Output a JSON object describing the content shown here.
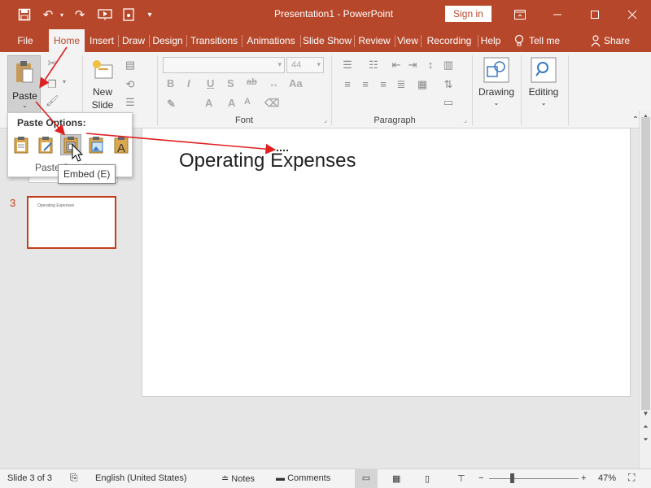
{
  "titlebar": {
    "title": "Presentation1  -  PowerPoint",
    "signin_label": "Sign in",
    "qat_icons": [
      "save-icon",
      "undo-icon",
      "redo-icon",
      "present-from-start-icon",
      "touch-mode-icon",
      "customize-qat-icon"
    ],
    "window_icons": [
      "ribbon-display-options-icon",
      "minimize-icon",
      "restore-icon",
      "close-icon"
    ]
  },
  "tabs": [
    {
      "label": "File"
    },
    {
      "label": "Home"
    },
    {
      "label": "Insert"
    },
    {
      "label": "Draw"
    },
    {
      "label": "Design"
    },
    {
      "label": "Transitions"
    },
    {
      "label": "Animations"
    },
    {
      "label": "Slide Show"
    },
    {
      "label": "Review"
    },
    {
      "label": "View"
    },
    {
      "label": "Recording"
    },
    {
      "label": "Help"
    },
    {
      "label": "Tell me"
    },
    {
      "label": "Share"
    }
  ],
  "active_tab": "Home",
  "ribbon": {
    "paste_label": "Paste",
    "new_slide_label_1": "New",
    "new_slide_label_2": "Slide",
    "font_size_value": "44",
    "font_group_label": "Font",
    "paragraph_group_label": "Paragraph",
    "drawing_label": "Drawing",
    "editing_label": "Editing",
    "format_buttons": [
      "B",
      "I",
      "U",
      "S",
      "ab",
      "Aa",
      "A",
      "A"
    ]
  },
  "paste_menu": {
    "header": "Paste Options:",
    "options": [
      {
        "name": "use-destination-theme",
        "icon": "clipboard-icon"
      },
      {
        "name": "keep-source-formatting",
        "icon": "clipboard-brush-icon"
      },
      {
        "name": "embed",
        "icon": "clipboard-embed-icon"
      },
      {
        "name": "picture",
        "icon": "clipboard-picture-icon"
      },
      {
        "name": "keep-text-only",
        "icon": "clipboard-text-icon"
      }
    ],
    "hovered": "embed",
    "tooltip": "Embed (E)",
    "footer": "Paste Speci..."
  },
  "thumbnails": [
    {
      "number": "3",
      "title": "Operating Expenses"
    }
  ],
  "slide": {
    "title": "Operating Expenses"
  },
  "statusbar": {
    "slide_info": "Slide 3 of 3",
    "language": "English (United States)",
    "notes_label": "Notes",
    "comments_label": "Comments",
    "zoom_level": "47%",
    "zoom_fraction": 0.47
  },
  "colors": {
    "accent": "#b7472a",
    "thumb_border": "#c43e1c",
    "annotation_arrow": "#e02020"
  }
}
